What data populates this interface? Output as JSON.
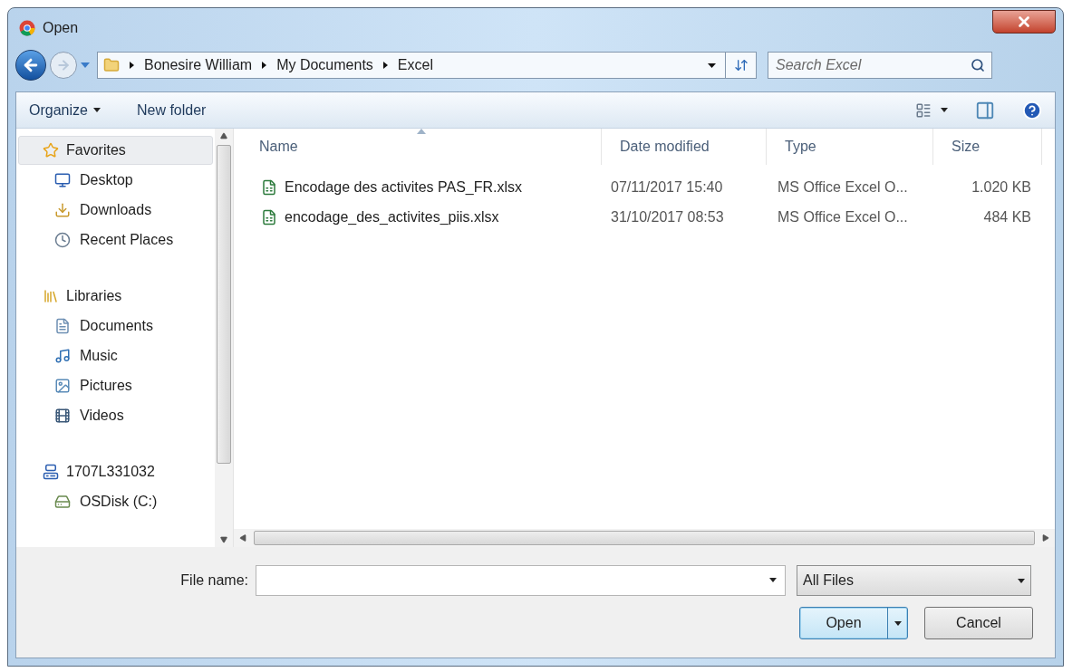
{
  "window": {
    "title": "Open"
  },
  "address": {
    "crumbs": [
      "Bonesire William",
      "My Documents",
      "Excel"
    ],
    "search_placeholder": "Search Excel"
  },
  "toolbar": {
    "organize": "Organize",
    "new_folder": "New folder"
  },
  "sidebar": {
    "groups": [
      {
        "label": "Favorites",
        "selected": true,
        "children": [
          {
            "label": "Desktop",
            "selected": false
          },
          {
            "label": "Downloads",
            "selected": false
          },
          {
            "label": "Recent Places",
            "selected": false
          }
        ]
      },
      {
        "label": "Libraries",
        "selected": false,
        "children": [
          {
            "label": "Documents",
            "selected": false
          },
          {
            "label": "Music",
            "selected": false
          },
          {
            "label": "Pictures",
            "selected": false
          },
          {
            "label": "Videos",
            "selected": false
          }
        ]
      },
      {
        "label": "1707L331032",
        "selected": false,
        "children": [
          {
            "label": "OSDisk (C:)",
            "selected": false
          }
        ]
      }
    ]
  },
  "table": {
    "columns": [
      {
        "label": "Name",
        "sorted": true
      },
      {
        "label": "Date modified",
        "sorted": false
      },
      {
        "label": "Type",
        "sorted": false
      },
      {
        "label": "Size",
        "sorted": false
      }
    ],
    "rows": [
      {
        "name": "Encodage des activites PAS_FR.xlsx",
        "date": "07/11/2017 15:40",
        "type": "MS Office Excel O...",
        "size": "1.020 KB",
        "selected": false
      },
      {
        "name": "encodage_des_activites_piis.xlsx",
        "date": "31/10/2017 08:53",
        "type": "MS Office Excel O...",
        "size": "484 KB",
        "selected": false
      }
    ]
  },
  "footer": {
    "file_name_label": "File name:",
    "filter": "All Files",
    "buttons": [
      {
        "label": "Open",
        "kind": "split",
        "default": true
      },
      {
        "label": "Cancel",
        "kind": "plain",
        "default": false
      }
    ]
  }
}
